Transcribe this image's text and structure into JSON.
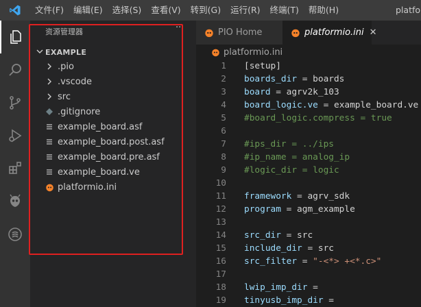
{
  "menu": [
    "文件(F)",
    "编辑(E)",
    "选择(S)",
    "查看(V)",
    "转到(G)",
    "运行(R)",
    "终端(T)",
    "帮助(H)"
  ],
  "window_title": "platfo",
  "activity_icons": [
    "files-icon",
    "search-icon",
    "source-control-icon",
    "run-debug-icon",
    "extensions-icon",
    "platformio-alien-icon",
    "remote-icon"
  ],
  "sidebar": {
    "title": "资源管理器",
    "more": "···",
    "root_folder": "EXAMPLE",
    "items": [
      {
        "label": ".pio",
        "icon": "chevron-right-icon"
      },
      {
        "label": ".vscode",
        "icon": "chevron-right-icon"
      },
      {
        "label": "src",
        "icon": "chevron-right-icon"
      },
      {
        "label": ".gitignore",
        "icon": "gitignore-icon"
      },
      {
        "label": "example_board.asf",
        "icon": "file-lines-icon"
      },
      {
        "label": "example_board.post.asf",
        "icon": "file-lines-icon"
      },
      {
        "label": "example_board.pre.asf",
        "icon": "file-lines-icon"
      },
      {
        "label": "example_board.ve",
        "icon": "file-lines-icon"
      },
      {
        "label": "platformio.ini",
        "icon": "platformio-icon"
      }
    ]
  },
  "tabs": [
    {
      "label": "PIO Home",
      "active": false
    },
    {
      "label": "platformio.ini",
      "active": true,
      "close": "✕"
    }
  ],
  "breadcrumb": "platformio.ini",
  "code": [
    {
      "n": "1",
      "tokens": [
        {
          "t": "[setup]",
          "c": "p"
        }
      ]
    },
    {
      "n": "2",
      "tokens": [
        {
          "t": "boards_dir",
          "c": "k"
        },
        {
          "t": " = boards",
          "c": "p"
        }
      ]
    },
    {
      "n": "3",
      "tokens": [
        {
          "t": "board",
          "c": "k"
        },
        {
          "t": " = agrv2k_103",
          "c": "p"
        }
      ]
    },
    {
      "n": "4",
      "tokens": [
        {
          "t": "board_logic.ve",
          "c": "k"
        },
        {
          "t": " = example_board.ve",
          "c": "p"
        }
      ]
    },
    {
      "n": "5",
      "tokens": [
        {
          "t": "#board_logic.compress = true",
          "c": "c"
        }
      ]
    },
    {
      "n": "6",
      "tokens": []
    },
    {
      "n": "7",
      "tokens": [
        {
          "t": "#ips_dir = ../ips",
          "c": "c"
        }
      ]
    },
    {
      "n": "8",
      "tokens": [
        {
          "t": "#ip_name = analog_ip",
          "c": "c"
        }
      ]
    },
    {
      "n": "9",
      "tokens": [
        {
          "t": "#logic_dir = logic",
          "c": "c"
        }
      ]
    },
    {
      "n": "10",
      "tokens": []
    },
    {
      "n": "11",
      "tokens": [
        {
          "t": "framework",
          "c": "k"
        },
        {
          "t": " = agrv_sdk",
          "c": "p"
        }
      ]
    },
    {
      "n": "12",
      "tokens": [
        {
          "t": "program",
          "c": "k"
        },
        {
          "t": " = agm_example",
          "c": "p"
        }
      ]
    },
    {
      "n": "13",
      "tokens": []
    },
    {
      "n": "14",
      "tokens": [
        {
          "t": "src_dir",
          "c": "k"
        },
        {
          "t": " = src",
          "c": "p"
        }
      ]
    },
    {
      "n": "15",
      "tokens": [
        {
          "t": "include_dir",
          "c": "k"
        },
        {
          "t": " = src",
          "c": "p"
        }
      ]
    },
    {
      "n": "16",
      "tokens": [
        {
          "t": "src_filter",
          "c": "k"
        },
        {
          "t": " = ",
          "c": "p"
        },
        {
          "t": "\"-<*> +<*.c>\"",
          "c": "s"
        }
      ]
    },
    {
      "n": "17",
      "tokens": []
    },
    {
      "n": "18",
      "tokens": [
        {
          "t": "lwip_imp_dir",
          "c": "k"
        },
        {
          "t": " =",
          "c": "p"
        }
      ]
    },
    {
      "n": "19",
      "tokens": [
        {
          "t": "tinyusb_imp_dir",
          "c": "k"
        },
        {
          "t": " =",
          "c": "p"
        }
      ]
    }
  ],
  "colors": {
    "highlight_box": "#e02020",
    "accent": "#007acc",
    "platformio": "#f5822a"
  }
}
